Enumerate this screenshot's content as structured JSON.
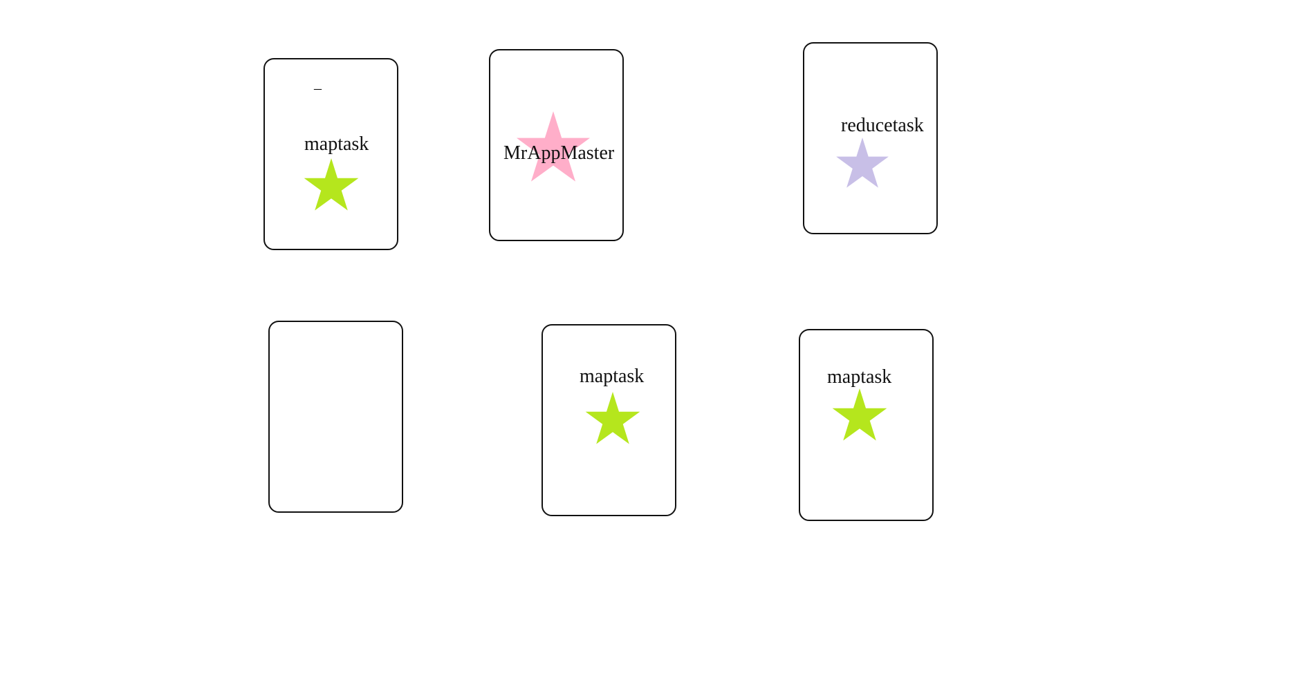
{
  "colors": {
    "maptask_star": "#b5e61d",
    "appmaster_star": "#ffaec9",
    "reducetask_star": "#c8bfe7",
    "border": "#111111"
  },
  "nodes": [
    {
      "dash": "_",
      "label": "maptask",
      "star_icon": "green-star-icon"
    },
    {
      "label": "MrAppMaster",
      "star_icon": "pink-star-icon"
    },
    {
      "label": "reducetask",
      "star_icon": "lavender-star-icon"
    },
    {
      "label": ""
    },
    {
      "label": "maptask",
      "star_icon": "green-star-icon"
    },
    {
      "label": "maptask",
      "star_icon": "green-star-icon"
    }
  ]
}
